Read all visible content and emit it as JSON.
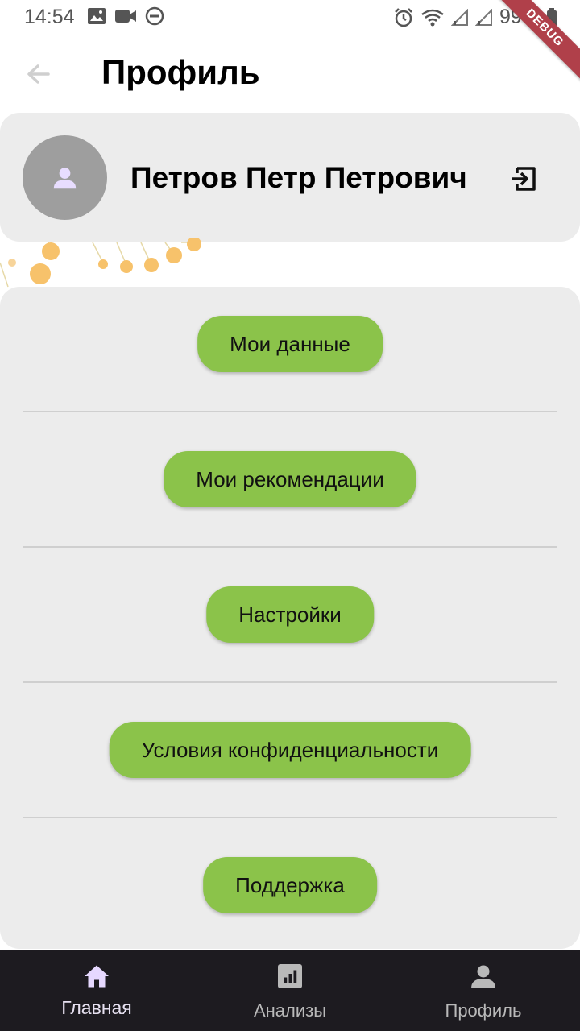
{
  "status_bar": {
    "time": "14:54",
    "battery": "99%",
    "debug_label": "DEBUG"
  },
  "app_bar": {
    "title": "Профиль"
  },
  "profile": {
    "name": "Петров Петр Петрович"
  },
  "menu": {
    "items": [
      {
        "label": "Мои данные"
      },
      {
        "label": "Мои рекомендации"
      },
      {
        "label": "Настройки"
      },
      {
        "label": "Условия конфиденциальности"
      },
      {
        "label": "Поддержка"
      }
    ]
  },
  "bottom_nav": {
    "items": [
      {
        "label": "Главная",
        "icon": "home-icon"
      },
      {
        "label": "Анализы",
        "icon": "chart-icon"
      },
      {
        "label": "Профиль",
        "icon": "person-icon"
      }
    ]
  },
  "colors": {
    "accent_button": "#8bc34a",
    "panel_background": "#ececec",
    "nav_background": "#1d1b20",
    "nav_active": "#e6e0f0"
  }
}
